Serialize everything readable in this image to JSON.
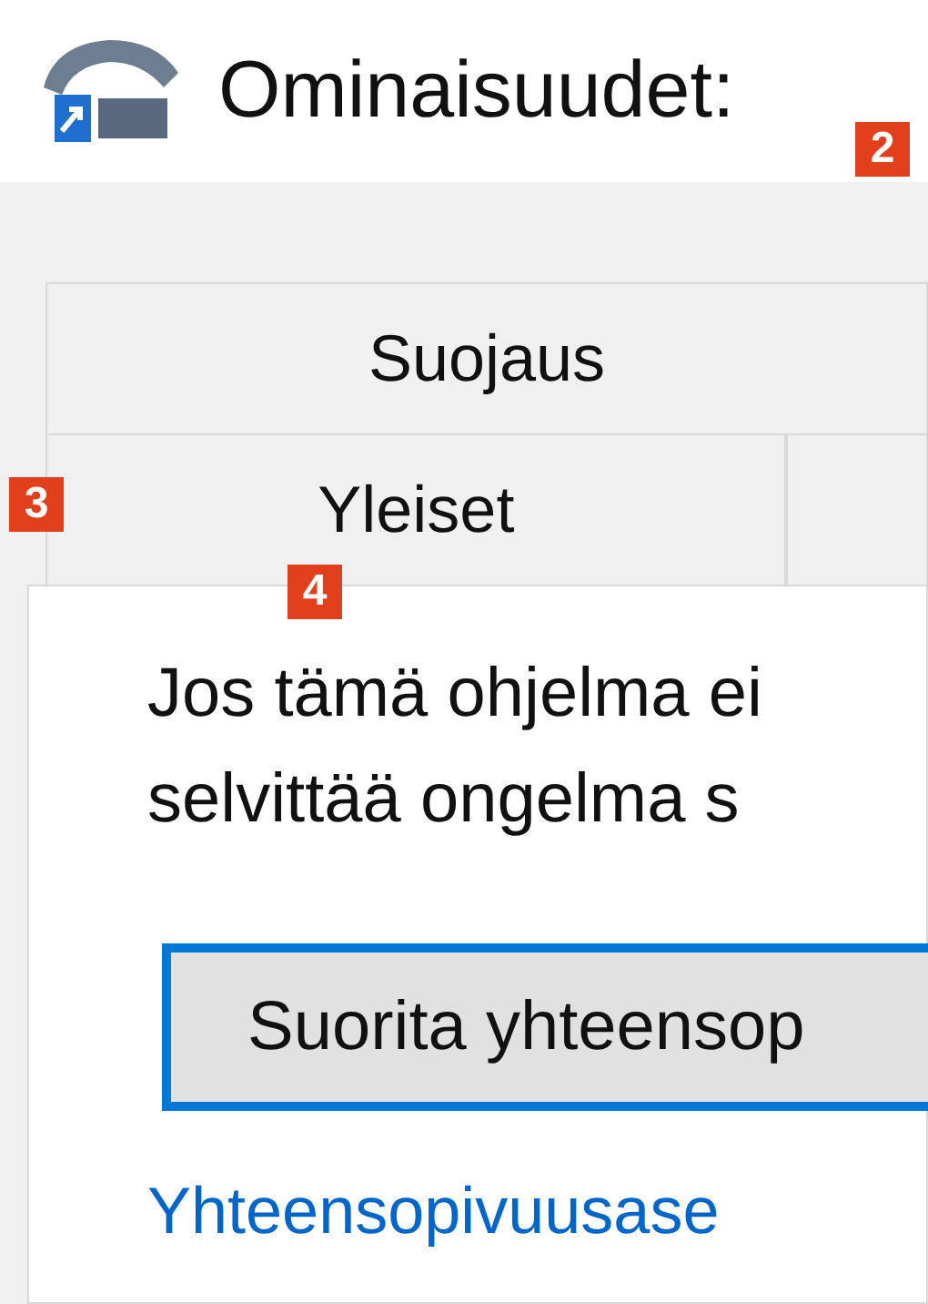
{
  "window": {
    "title": "Ominaisuudet:"
  },
  "tab_rows": [
    [
      {
        "label": "Suojaus",
        "selected": false
      }
    ],
    [
      {
        "label": "Yleiset",
        "selected": false
      },
      {
        "selected": false
      }
    ]
  ],
  "content": {
    "text_lines": [
      "Jos tämä ohjelma ei",
      "selvittää ongelma s"
    ],
    "button": "Suorita yhteensop",
    "link": "Yhteensopivuusase"
  },
  "callouts": [
    {
      "label": "2"
    },
    {
      "label": "3"
    },
    {
      "label": "4"
    }
  ]
}
